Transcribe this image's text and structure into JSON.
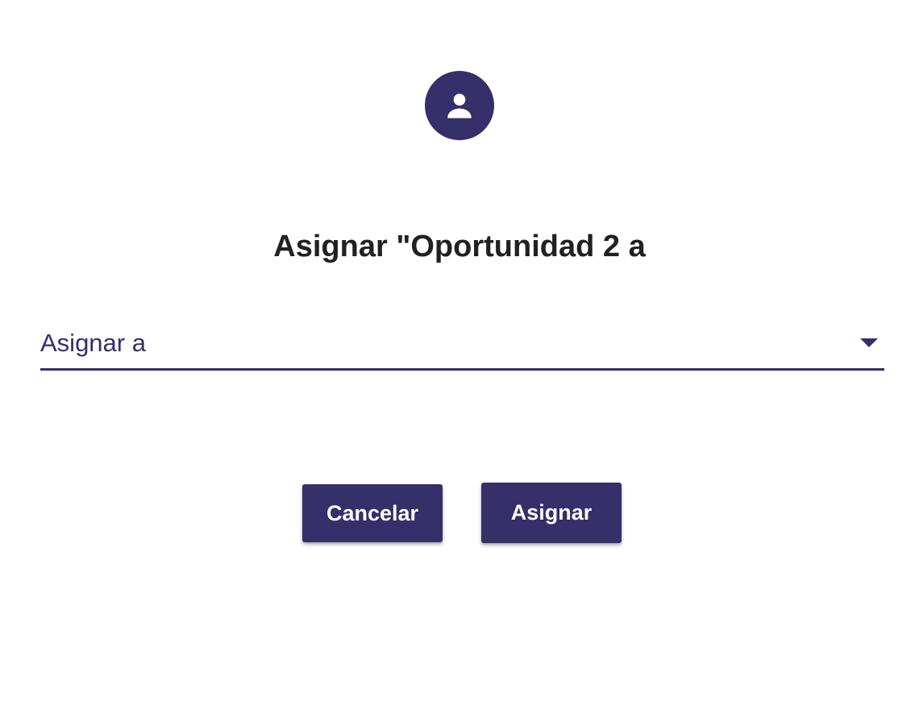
{
  "dialog": {
    "icon": "person-icon",
    "title": "Asignar \"Oportunidad 2 a",
    "select": {
      "label": "Asignar a",
      "arrow_icon": "dropdown-arrow-icon"
    },
    "buttons": {
      "cancel_label": "Cancelar",
      "assign_label": "Asignar"
    }
  },
  "colors": {
    "accent": "#352f6a",
    "title_text": "#212121",
    "background": "#ffffff"
  }
}
